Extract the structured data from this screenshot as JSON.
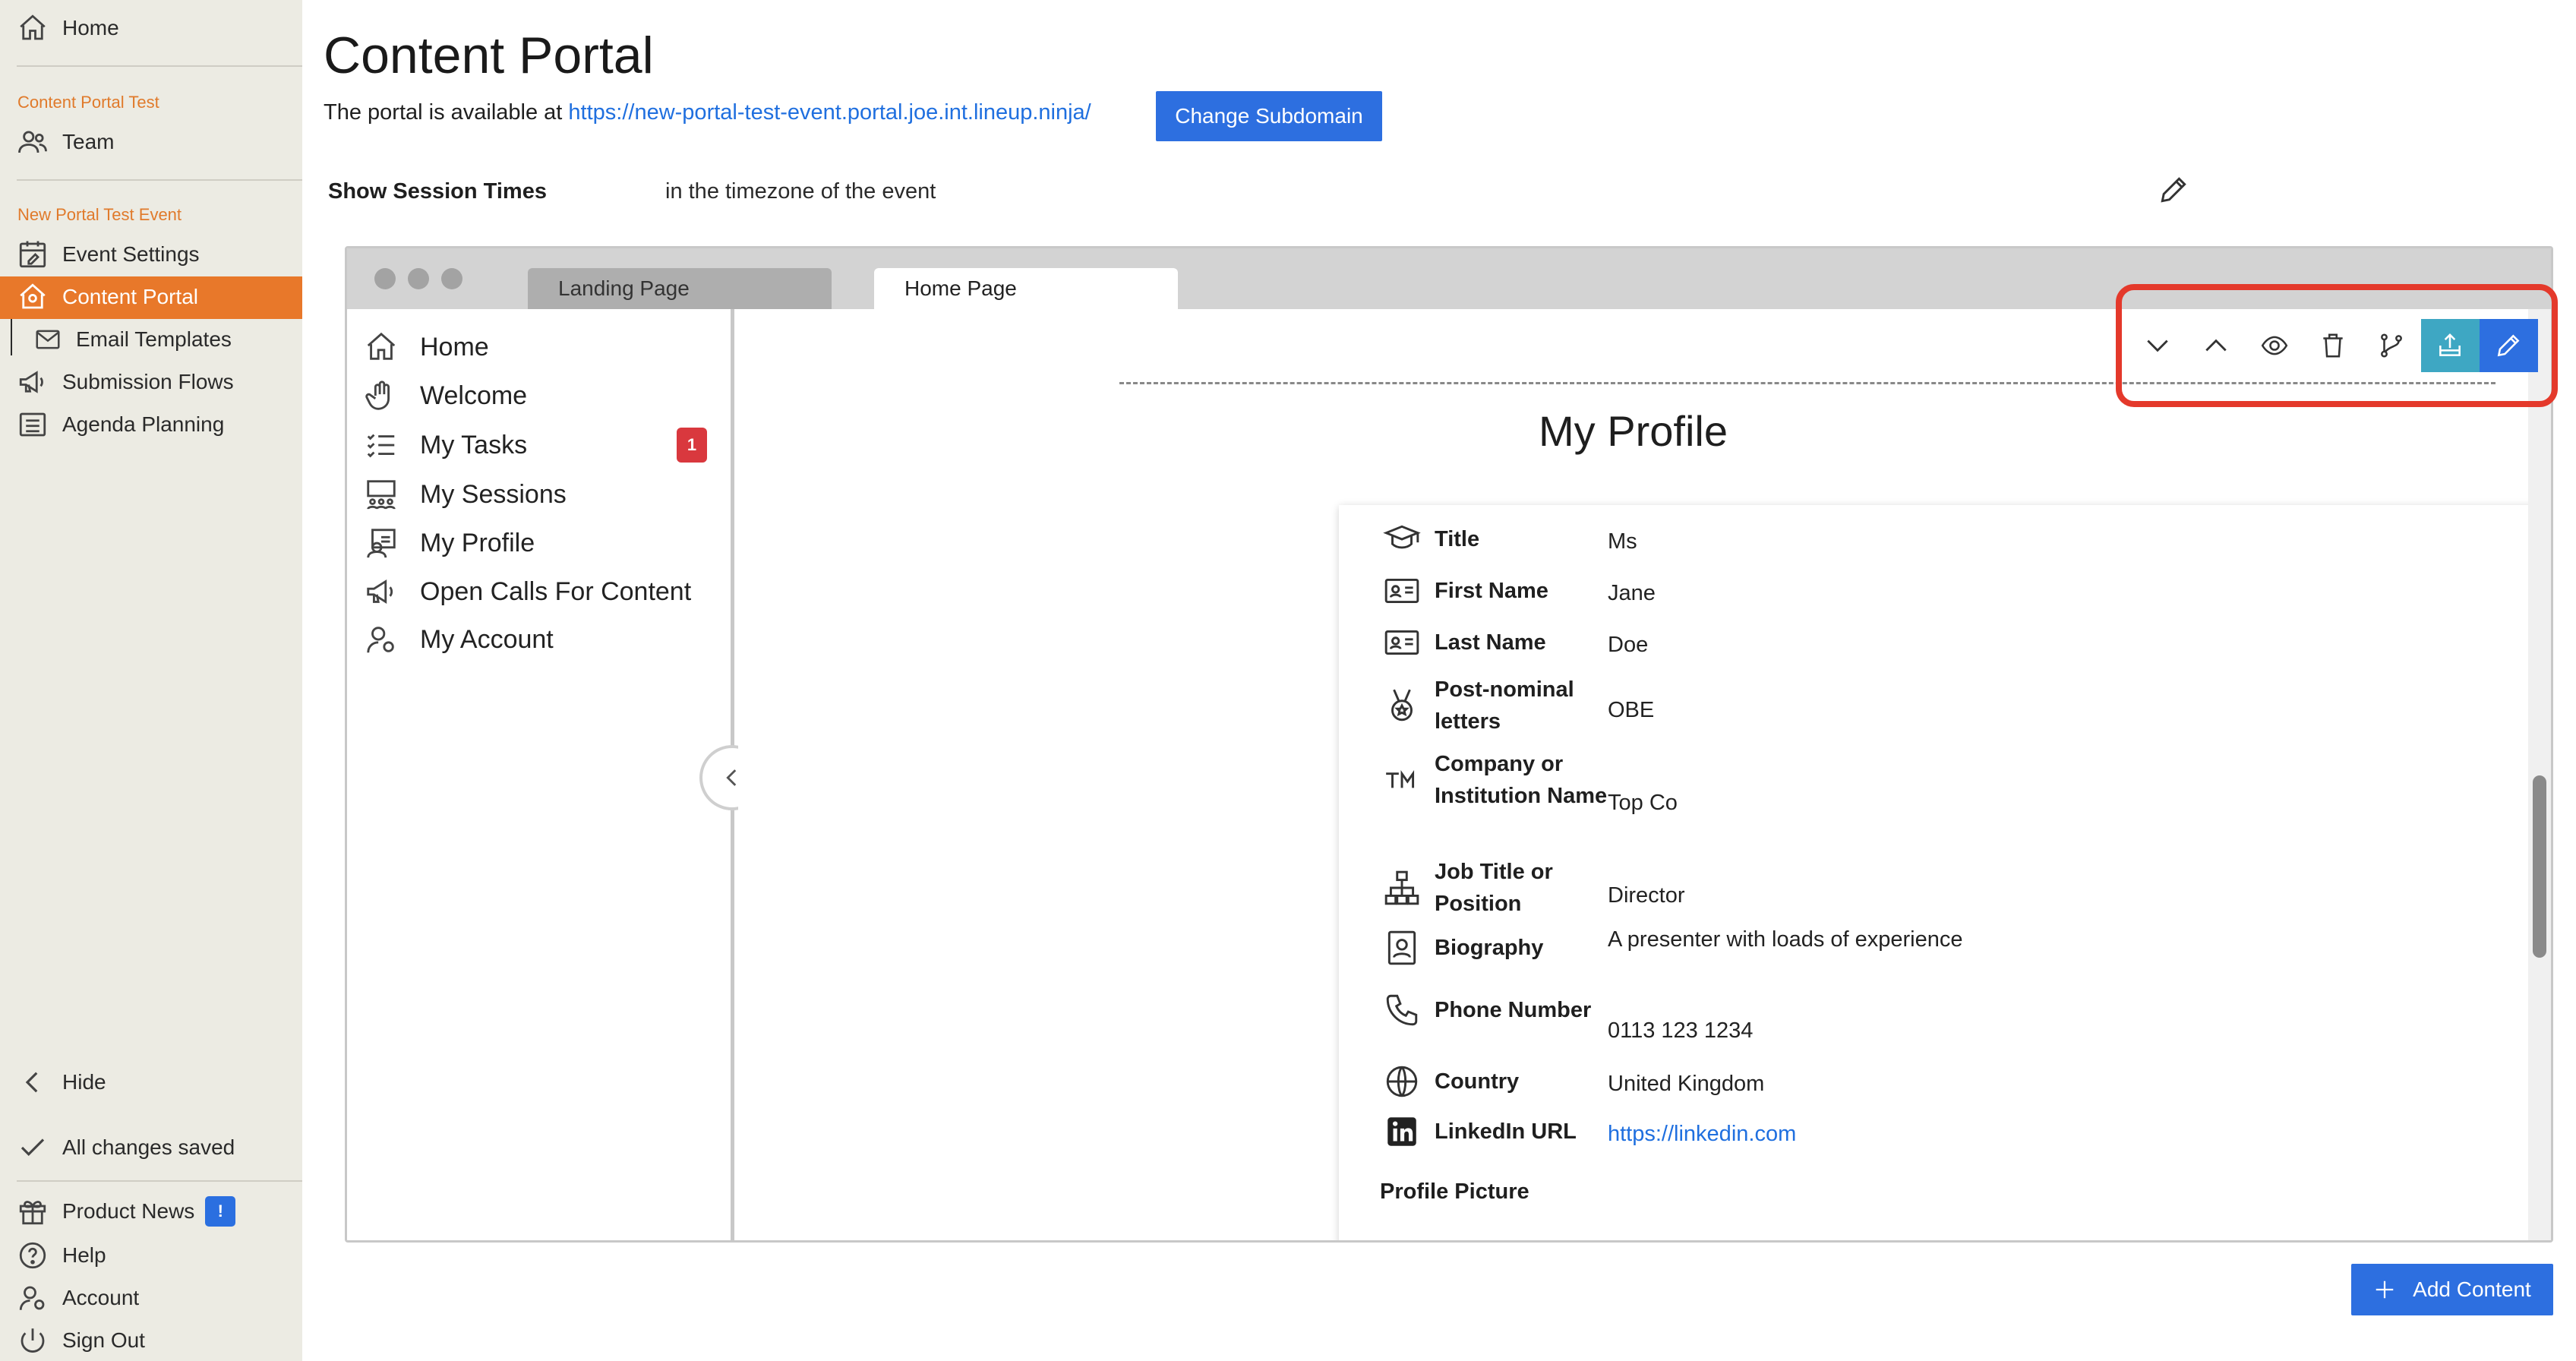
{
  "sidebar": {
    "home": "Home",
    "org_section": "Content Portal Test",
    "team": "Team",
    "event_section": "New Portal Test Event",
    "items": [
      {
        "label": "Event Settings"
      },
      {
        "label": "Content Portal"
      },
      {
        "label": "Email Templates"
      },
      {
        "label": "Submission Flows"
      },
      {
        "label": "Agenda Planning"
      }
    ],
    "hide": "Hide",
    "saved_status": "All changes saved",
    "product_news": "Product News",
    "product_news_badge": "!",
    "help": "Help",
    "account": "Account",
    "sign_out": "Sign Out"
  },
  "main": {
    "title": "Content Portal",
    "portal_text": "The portal is available at",
    "portal_url": "https://new-portal-test-event.portal.joe.int.lineup.ninja/",
    "change_subdomain": "Change Subdomain",
    "session_times_label": "Show Session Times",
    "session_times_value": "in the timezone of the event",
    "add_content": "Add Content"
  },
  "preview": {
    "tabs": [
      "Landing Page",
      "Home Page"
    ],
    "active_tab": "Home Page",
    "nav": [
      {
        "label": "Home",
        "icon": "home-icon"
      },
      {
        "label": "Welcome",
        "icon": "wave-hand-icon"
      },
      {
        "label": "My Tasks",
        "icon": "task-list-icon",
        "badge": "1"
      },
      {
        "label": "My Sessions",
        "icon": "sessions-icon"
      },
      {
        "label": "My Profile",
        "icon": "profile-icon"
      },
      {
        "label": "Open Calls For Content",
        "icon": "megaphone-icon"
      },
      {
        "label": "My Account",
        "icon": "account-icon"
      }
    ],
    "section_title": "My Profile",
    "fields": [
      {
        "label": "Title",
        "value": "Ms",
        "icon": "mortarboard-icon"
      },
      {
        "label": "First Name",
        "value": "Jane",
        "icon": "id-card-icon"
      },
      {
        "label": "Last Name",
        "value": "Doe",
        "icon": "id-card-icon"
      },
      {
        "label": "Post-nominal letters",
        "value": "OBE",
        "icon": "medal-icon"
      },
      {
        "label": "Company or Institution Name",
        "value": "Top Co",
        "icon": "trademark-icon"
      },
      {
        "label": "Job Title or Position",
        "value": "Director",
        "icon": "org-chart-icon"
      },
      {
        "label": "Biography",
        "value": "A presenter with loads of experience",
        "icon": "portrait-icon"
      },
      {
        "label": "Phone Number",
        "value": "0113 123 1234",
        "icon": "phone-icon"
      },
      {
        "label": "Country",
        "value": "United Kingdom",
        "icon": "globe-icon"
      },
      {
        "label": "LinkedIn URL",
        "value": "https://linkedin.com",
        "icon": "linkedin-icon"
      }
    ],
    "profile_picture_label": "Profile Picture"
  },
  "toolbar_icons": [
    "chevron-down-icon",
    "chevron-up-icon",
    "eye-icon",
    "trash-icon",
    "branch-icon",
    "publish-icon",
    "pencil-icon"
  ],
  "colors": {
    "accent": "#e8782a",
    "primary": "#2d6fe0",
    "teal": "#3ea7c3",
    "highlight": "#e4392b",
    "badge_red": "#d9383e"
  }
}
